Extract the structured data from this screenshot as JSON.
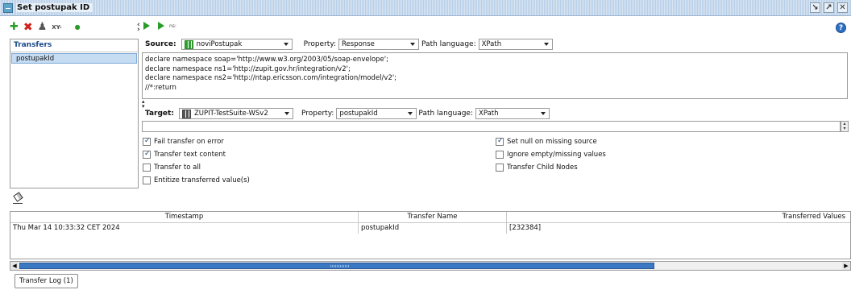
{
  "window": {
    "title": "Set postupak ID",
    "controls": [
      "restore",
      "maximize",
      "close"
    ]
  },
  "left_panel": {
    "toolbar_icons": [
      "add-icon",
      "delete-icon",
      "user-icon",
      "xy-icon",
      "dot-icon"
    ],
    "xy_label": "XY-",
    "header": "Transfers",
    "items": [
      "postupakId"
    ]
  },
  "right_toolbar": {
    "ns_label": "ns:",
    "help": "?"
  },
  "source": {
    "label": "Source:",
    "step": "noviPostupak",
    "property_label": "Property:",
    "property": "Response",
    "path_language_label": "Path language:",
    "path_language": "XPath",
    "expression": "declare namespace soap='http://www.w3.org/2003/05/soap-envelope';\ndeclare namespace ns1='http://zupit.gov.hr/integration/v2';\ndeclare namespace ns2='http://ntap.ericsson.com/integration/model/v2';\n//*:return"
  },
  "target": {
    "label": "Target:",
    "step": "ZUPIT-TestSuite-WSv2",
    "property_label": "Property:",
    "property": "postupakId",
    "path_language_label": "Path language:",
    "path_language": "XPath",
    "expression": ""
  },
  "options": {
    "left": [
      {
        "label": "Fail transfer on error",
        "checked": true
      },
      {
        "label": "Transfer text content",
        "checked": true
      },
      {
        "label": "Transfer to all",
        "checked": false
      },
      {
        "label": "Entitize transferred value(s)",
        "checked": false
      }
    ],
    "right": [
      {
        "label": "Set null on missing source",
        "checked": true
      },
      {
        "label": "Ignore empty/missing values",
        "checked": false
      },
      {
        "label": "Transfer Child Nodes",
        "checked": false
      }
    ]
  },
  "log": {
    "columns": [
      "Timestamp",
      "Transfer Name",
      "Transferred Values"
    ],
    "rows": [
      [
        "Thu Mar 14 10:33:32 CET 2024",
        "postupakId",
        "[232384]"
      ]
    ]
  },
  "tab": {
    "label": "Transfer Log (1)"
  },
  "colors": {
    "accent_blue": "#3b78c4",
    "green": "#2a9b28",
    "red": "#d0201b",
    "selection": "#c5dcf3"
  }
}
